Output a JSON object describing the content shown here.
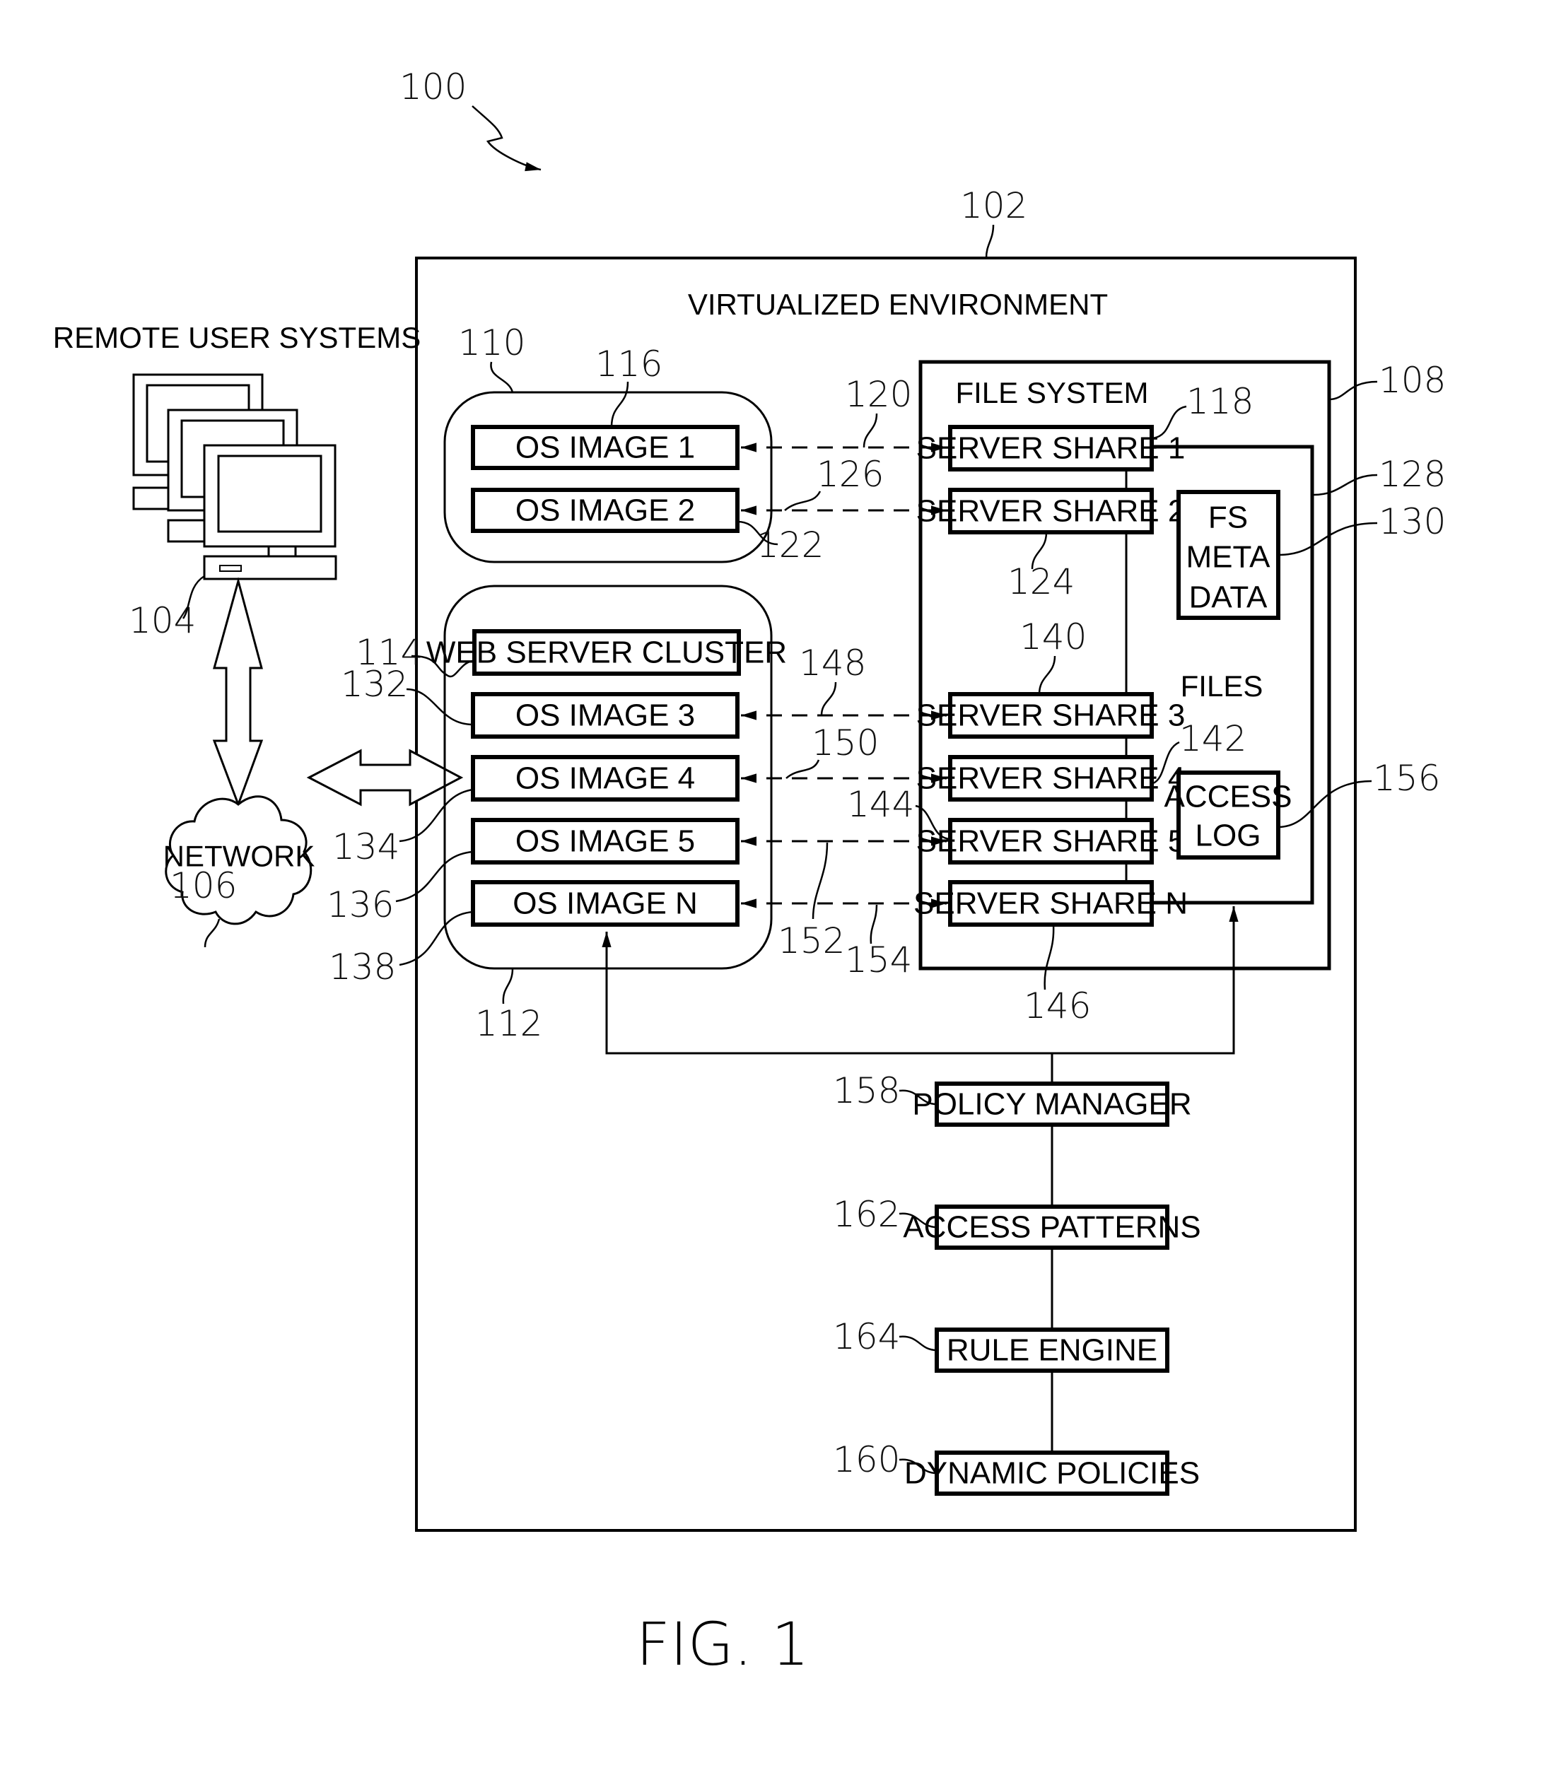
{
  "figure": {
    "caption": "FIG. 1",
    "system_ref": "100"
  },
  "remote_users": {
    "title": "REMOTE USER SYSTEMS",
    "ref": "104",
    "icon": "desktop-computers-icon"
  },
  "network": {
    "label": "NETWORK",
    "ref": "106",
    "icon": "cloud-icon"
  },
  "virtualized_environment": {
    "title": "VIRTUALIZED ENVIRONMENT",
    "ref": "102"
  },
  "group_110": {
    "ref": "110",
    "os_images": [
      {
        "label": "OS IMAGE 1",
        "ref": "116"
      },
      {
        "label": "OS IMAGE 2",
        "ref": "122"
      }
    ]
  },
  "group_112": {
    "ref": "112",
    "web_server": {
      "label": "WEB SERVER CLUSTER",
      "ref": "114"
    },
    "os_images": [
      {
        "label": "OS IMAGE 3",
        "ref": "132"
      },
      {
        "label": "OS IMAGE 4",
        "ref": "134"
      },
      {
        "label": "OS IMAGE 5",
        "ref": "136"
      },
      {
        "label": "OS IMAGE N",
        "ref": "138"
      }
    ]
  },
  "file_system": {
    "title": "FILE SYSTEM",
    "ref": "108",
    "files_label": "FILES",
    "files_ref": "128",
    "server_shares": [
      {
        "label": "SERVER SHARE 1",
        "ref": "118"
      },
      {
        "label": "SERVER SHARE 2",
        "ref": "124"
      },
      {
        "label": "SERVER SHARE 3",
        "ref": "140"
      },
      {
        "label": "SERVER SHARE 4",
        "ref": "142"
      },
      {
        "label": "SERVER SHARE 5",
        "ref": "144"
      },
      {
        "label": "SERVER SHARE N",
        "ref": "146"
      }
    ],
    "fs_metadata": {
      "lines": [
        "FS",
        "META",
        "DATA"
      ],
      "ref": "130"
    },
    "access_log": {
      "lines": [
        "ACCESS",
        "LOG"
      ],
      "ref": "156"
    }
  },
  "connections": [
    {
      "ref": "120",
      "from": "OS IMAGE 1",
      "to": "SERVER SHARE 1"
    },
    {
      "ref": "126",
      "from": "OS IMAGE 2",
      "to": "SERVER SHARE 2"
    },
    {
      "ref": "148",
      "from": "OS IMAGE 3",
      "to": "SERVER SHARE 3"
    },
    {
      "ref": "150",
      "from": "OS IMAGE 4",
      "to": "SERVER SHARE 4"
    },
    {
      "ref": "152",
      "from": "OS IMAGE 5",
      "to": "SERVER SHARE 5"
    },
    {
      "ref": "154",
      "from": "OS IMAGE N",
      "to": "SERVER SHARE N"
    }
  ],
  "policy_stack": [
    {
      "label": "POLICY MANAGER",
      "ref": "158"
    },
    {
      "label": "ACCESS PATTERNS",
      "ref": "162"
    },
    {
      "label": "RULE ENGINE",
      "ref": "164"
    },
    {
      "label": "DYNAMIC POLICIES",
      "ref": "160"
    }
  ]
}
